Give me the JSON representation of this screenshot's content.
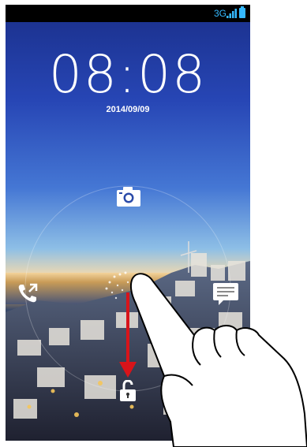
{
  "status_bar": {
    "network": "3G",
    "icons": [
      "signal-icon",
      "battery-icon"
    ],
    "accent_color": "#35b9ff"
  },
  "lockscreen": {
    "time": "08:08",
    "date": "2014/09/09"
  },
  "shortcuts": [
    "camera-icon",
    "phone-icon",
    "message-icon",
    "unlock-icon"
  ],
  "gesture": "swipe-down-arrow-icon"
}
